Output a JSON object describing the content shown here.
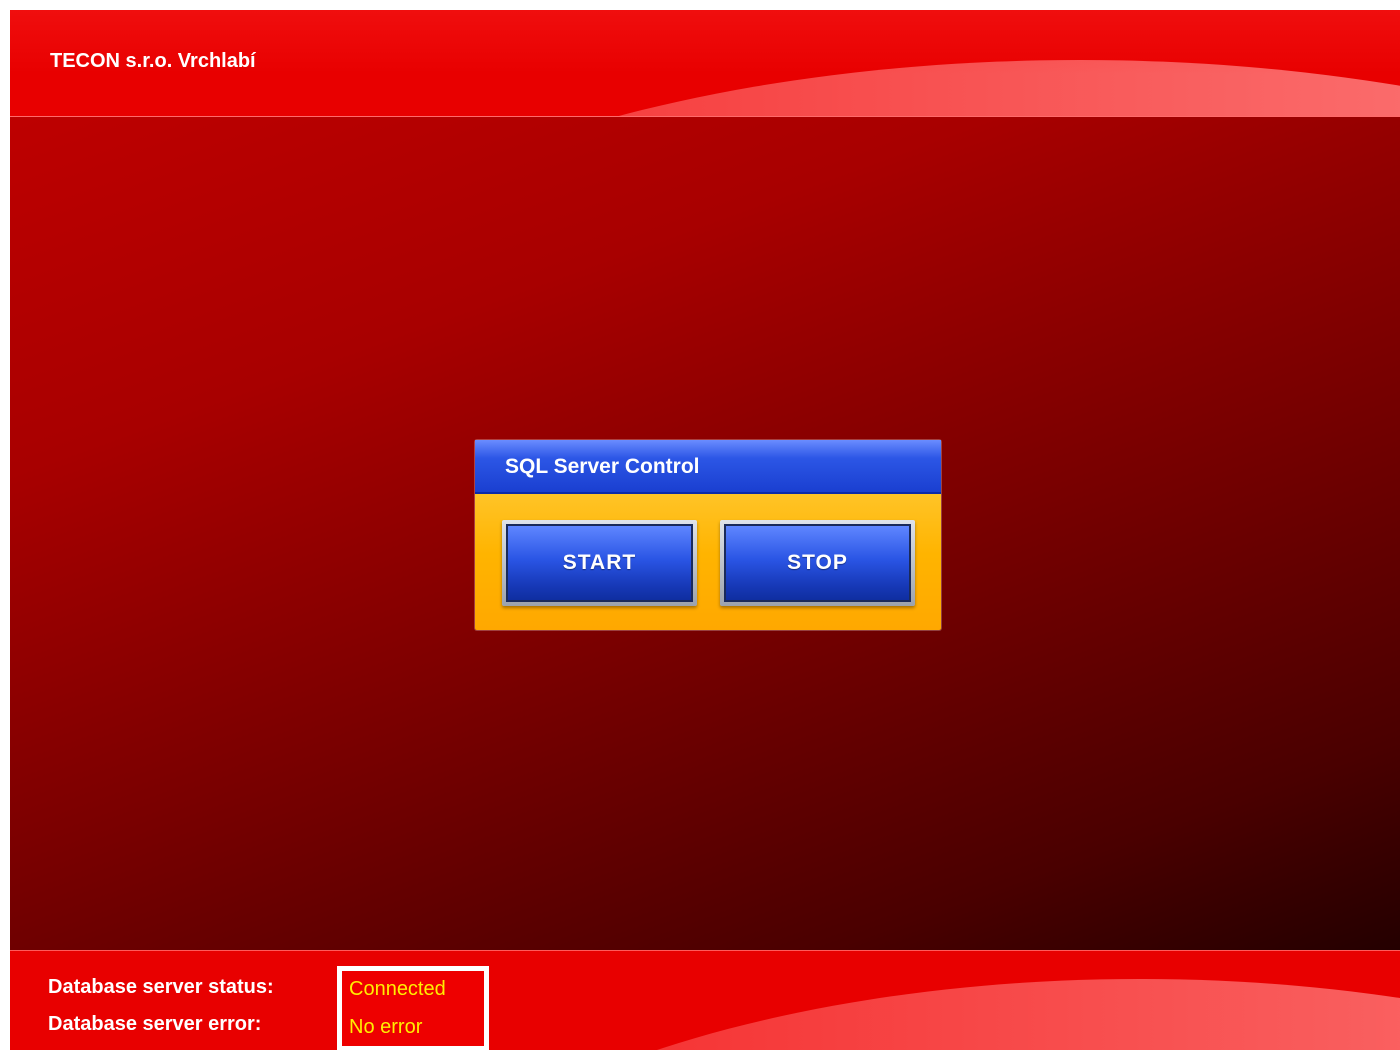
{
  "header": {
    "company_name": "TECON s.r.o. Vrchlabí"
  },
  "sql_panel": {
    "title": "SQL Server Control",
    "start_label": "START",
    "stop_label": "STOP"
  },
  "footer": {
    "status_label": "Database server status:",
    "status_value": "Connected",
    "error_label": "Database server error:",
    "error_value": "No error"
  },
  "colors": {
    "background_red": "#c40000",
    "header_red": "#e80000",
    "panel_blue": "#2a55e5",
    "panel_orange": "#ffb400",
    "status_text_yellow": "#ffee00"
  }
}
